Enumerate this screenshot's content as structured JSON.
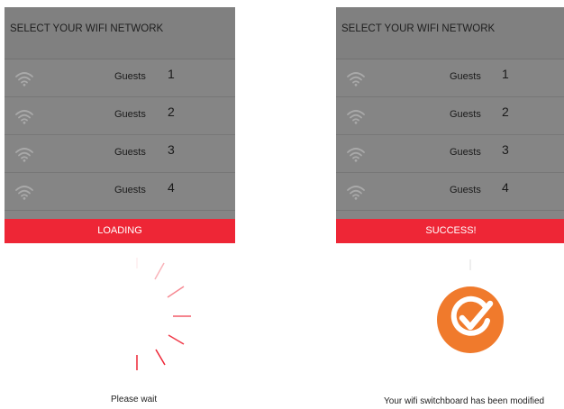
{
  "left_panel": {
    "header": "SELECT YOUR WIFI NETWORK",
    "networks": [
      {
        "name": "Guests",
        "number": "1"
      },
      {
        "name": "Guests",
        "number": "2"
      },
      {
        "name": "Guests",
        "number": "3"
      },
      {
        "name": "Guests",
        "number": "4"
      }
    ],
    "status": "LOADING",
    "caption": "Please wait"
  },
  "right_panel": {
    "header": "SELECT YOUR WIFI NETWORK",
    "networks": [
      {
        "name": "Guests",
        "number": "1"
      },
      {
        "name": "Guests",
        "number": "2"
      },
      {
        "name": "Guests",
        "number": "3"
      },
      {
        "name": "Guests",
        "number": "4"
      }
    ],
    "status": "SUCCESS!",
    "caption": "Your wifi switchboard has been modified"
  },
  "colors": {
    "panel_bg": "#858585",
    "status_bar": "#ee2636",
    "success_circle": "#f07a2c",
    "spinner": "#ee2636"
  },
  "icons": {
    "network": "wifi-icon",
    "success": "check-circle-icon",
    "loading": "spinner-icon"
  }
}
